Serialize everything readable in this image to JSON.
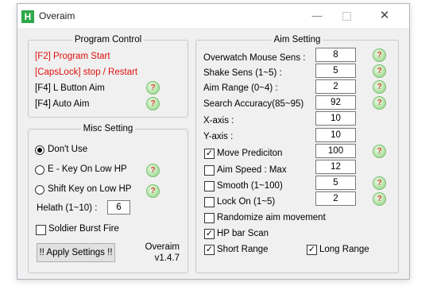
{
  "window": {
    "title": "Overaim",
    "app_icon_letter": "H",
    "controls": {
      "minimize": "—",
      "close": "✕"
    }
  },
  "program_control": {
    "legend": "Program Control",
    "items": [
      {
        "label": "[F2] Program Start"
      },
      {
        "label": "[CapsLock] stop / Restart"
      },
      {
        "label": "[F4] L Button Aim"
      },
      {
        "label": "[F4] Auto Aim"
      }
    ],
    "help_glyph": "?"
  },
  "misc_setting": {
    "legend": "Misc Setting",
    "radios": [
      {
        "label": "Don't Use",
        "selected": true
      },
      {
        "label": "E - Key On Low HP",
        "selected": false
      },
      {
        "label": "Shift Key on Low HP",
        "selected": false
      }
    ],
    "health_label": "Helath (1~10) :",
    "health_value": "6",
    "soldier_label": "Soldier Burst Fire",
    "soldier_checked": false,
    "apply_label": "!! Apply Settings !!",
    "app_name": "Overaim",
    "version": "v1.4.7"
  },
  "aim_setting": {
    "legend": "Aim Setting",
    "fields": [
      {
        "label": "Overwatch Mouse Sens  :",
        "value": "8"
      },
      {
        "label": "Shake Sens (1~5)      :",
        "value": "5"
      },
      {
        "label": "Aim Range (0~4)   :",
        "value": "2"
      },
      {
        "label": "Search Accuracy(85~95)",
        "value": "92"
      },
      {
        "label": "X-axis :",
        "value": "10"
      },
      {
        "label": "Y-axis :",
        "value": "10"
      }
    ],
    "checks": [
      {
        "label": "Move Prediciton",
        "checked": true,
        "value": "100"
      },
      {
        "label": "Aim Speed : Max",
        "checked": false,
        "value": "12"
      },
      {
        "label": "Smooth (1~100)",
        "checked": false,
        "value": "5"
      },
      {
        "label": "Lock On (1~5)",
        "checked": false,
        "value": "2"
      },
      {
        "label": "Randomize aim movement",
        "checked": false
      },
      {
        "label": "HP bar Scan",
        "checked": true
      },
      {
        "label": "Short Range",
        "checked": true
      },
      {
        "label": "Long Range",
        "checked": true
      }
    ],
    "check_glyph": "✓"
  }
}
